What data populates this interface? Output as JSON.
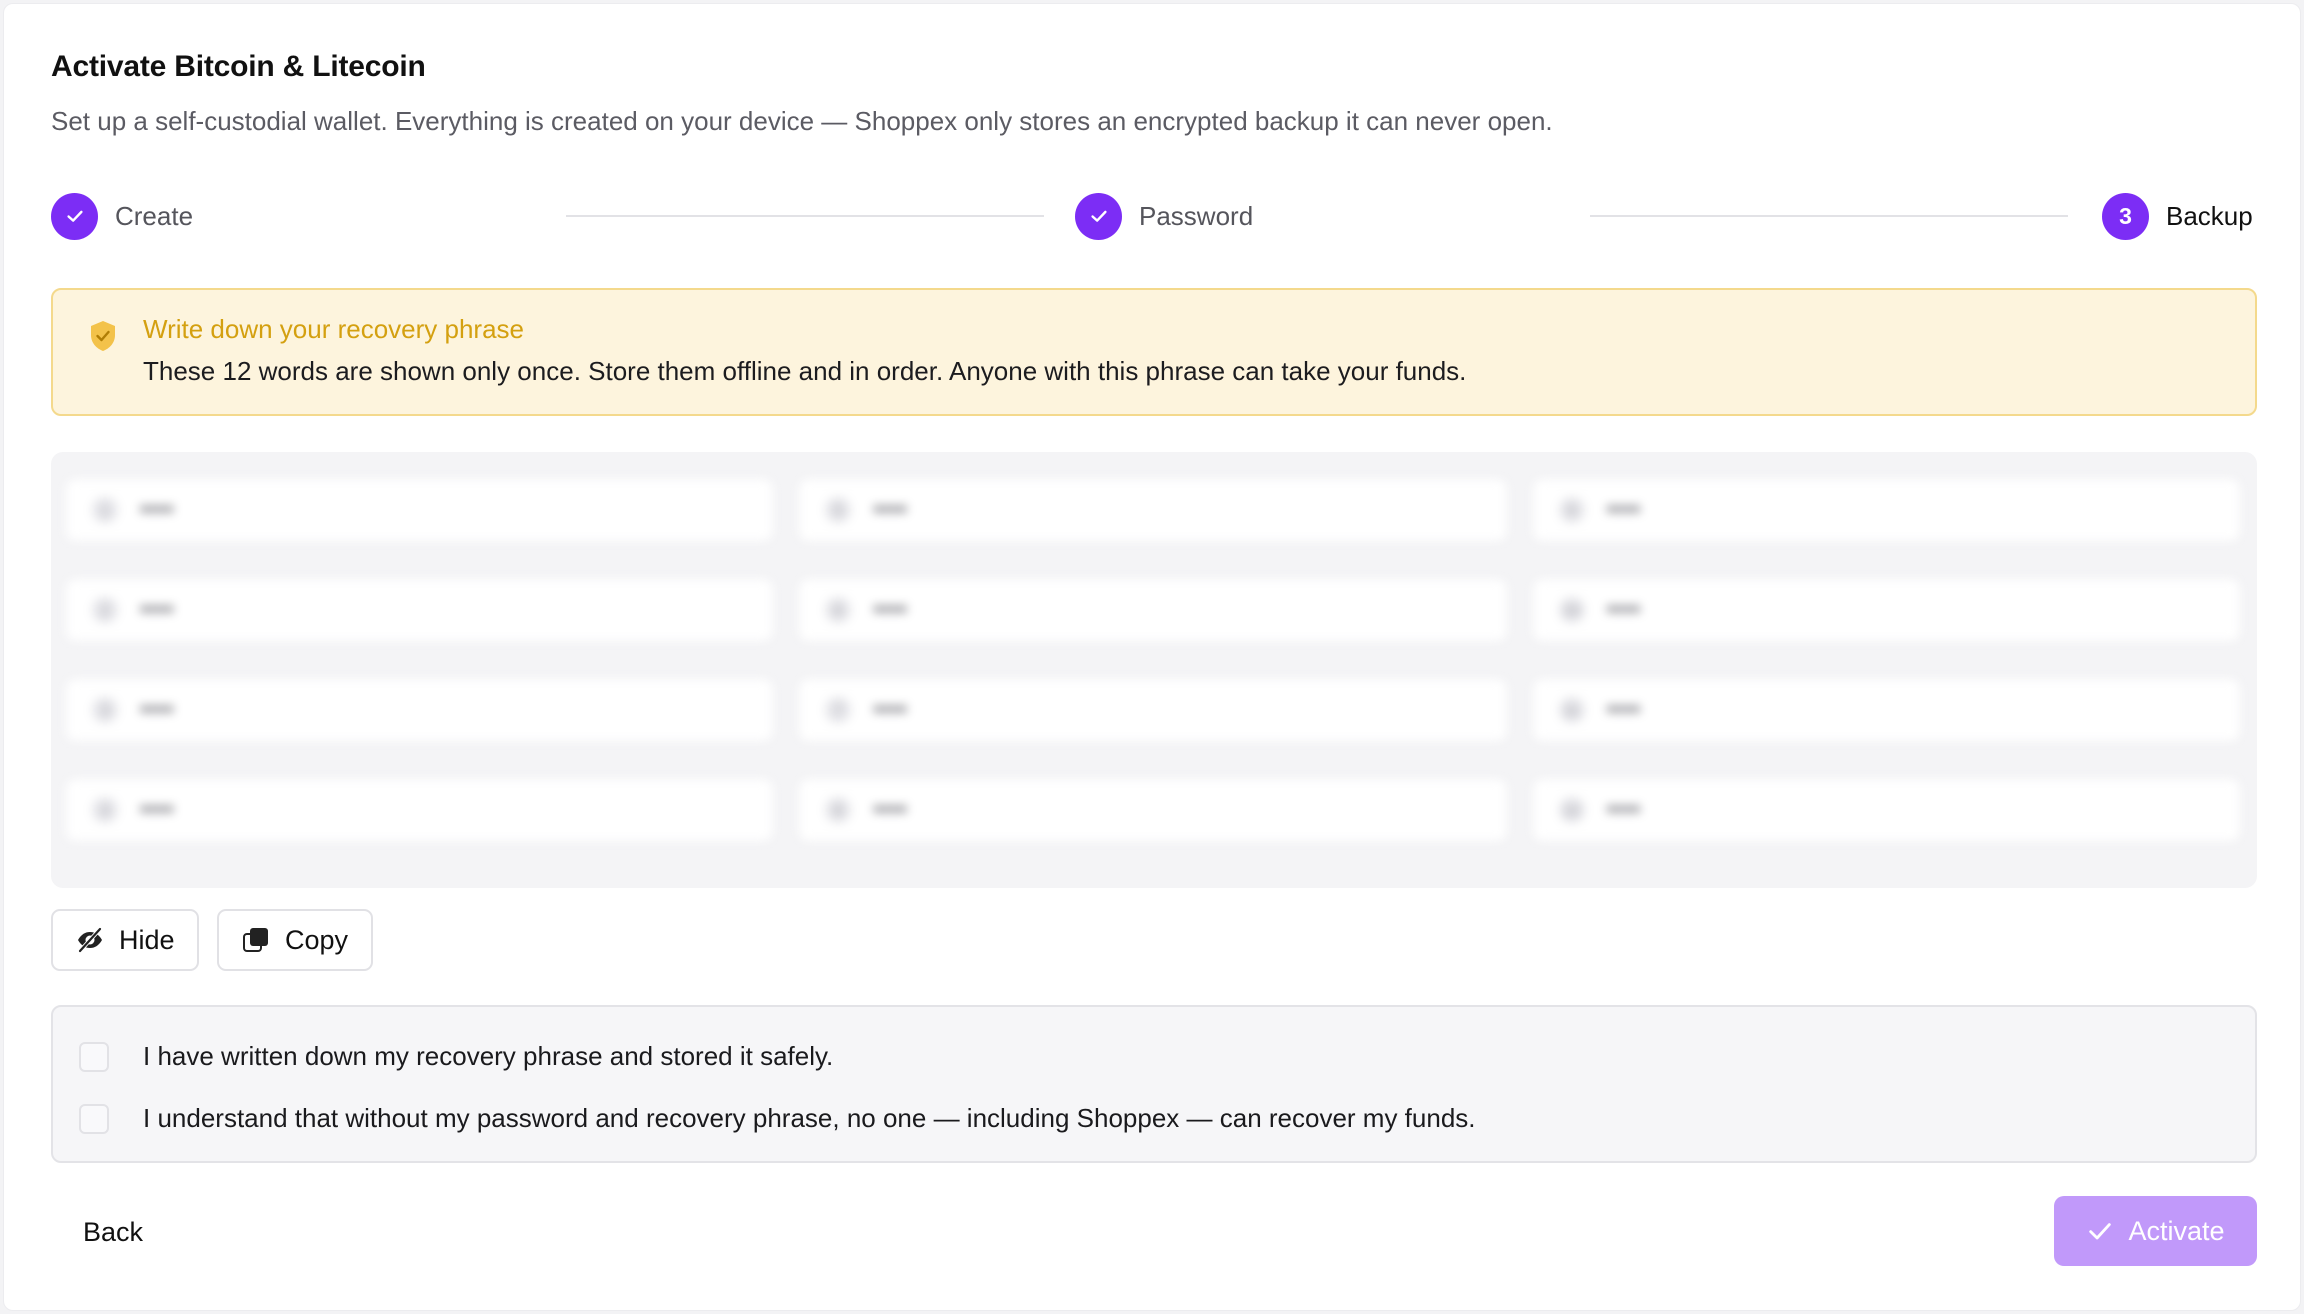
{
  "dialog": {
    "title": "Activate Bitcoin & Litecoin",
    "subtitle": "Set up a self-custodial wallet. Everything is created on your device — Shoppex only stores an encrypted backup it can never open."
  },
  "stepper": {
    "steps": [
      {
        "label": "Create",
        "state": "complete",
        "icon": "check-icon"
      },
      {
        "label": "Password",
        "state": "complete",
        "icon": "check-icon"
      },
      {
        "label": "Backup",
        "state": "active",
        "number": "3"
      }
    ],
    "accent_color": "#7c2df5"
  },
  "warning": {
    "icon": "shield-check-icon",
    "title": "Write down your recovery phrase",
    "text": "These 12 words are shown only once. Store them offline and in order. Anyone with this phrase can take your funds.",
    "title_color": "#d4a010"
  },
  "phrase": {
    "state": "hidden (blurred)"
  },
  "actions": {
    "hide_label": "Hide",
    "hide_icon": "eye-off-icon",
    "copy_label": "Copy",
    "copy_icon": "copy-icon"
  },
  "consent": {
    "items": [
      {
        "label": "I have written down my recovery phrase and stored it safely.",
        "checked": false
      },
      {
        "label": "I understand that without my password and recovery phrase, no one — including Shoppex — can recover my funds.",
        "checked": false
      }
    ]
  },
  "footer": {
    "back_label": "Back",
    "activate_label": "Activate",
    "activate_icon": "check-icon",
    "activate_disabled": true
  }
}
